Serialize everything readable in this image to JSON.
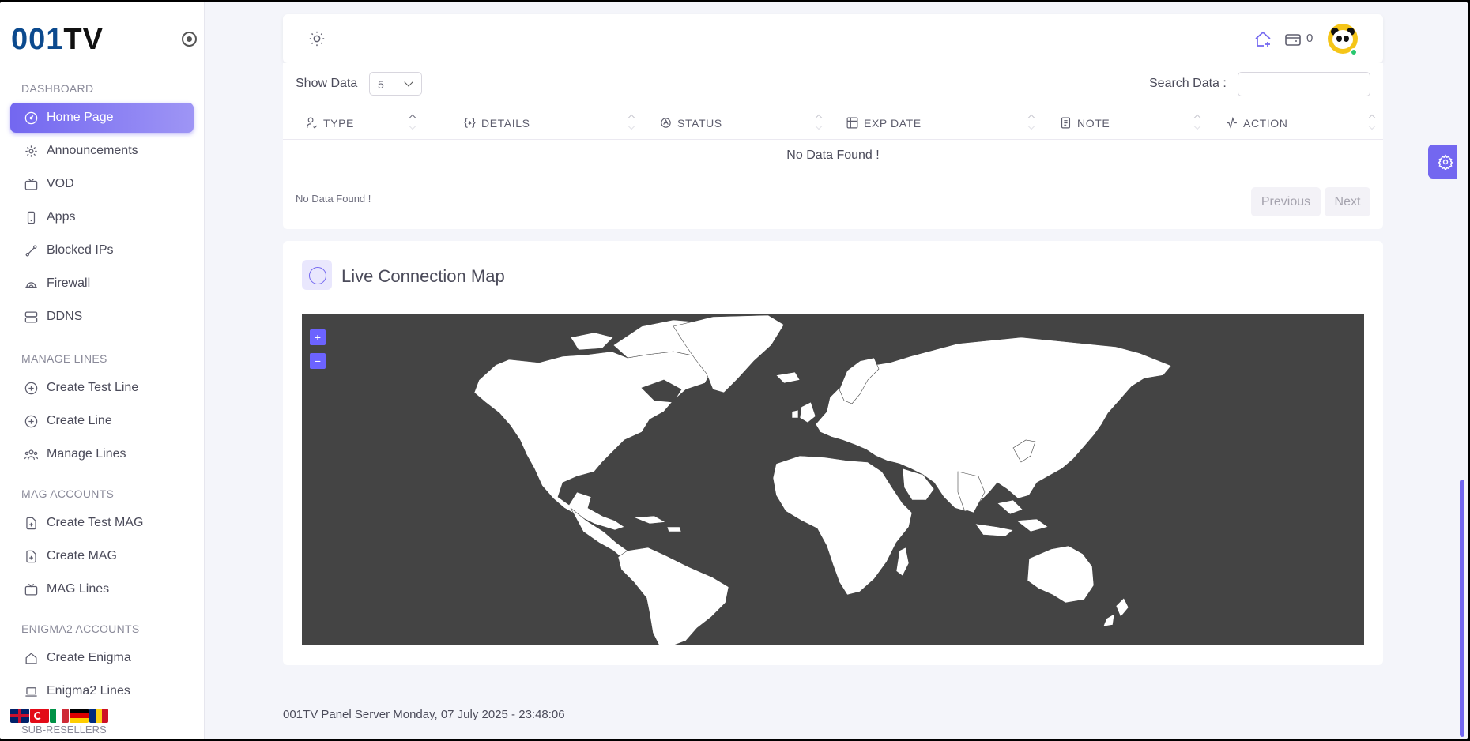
{
  "brand": {
    "logo_main": "001",
    "logo_accent": "TV"
  },
  "sidebar": {
    "sections": [
      {
        "title": "DASHBOARD",
        "items": [
          {
            "label": "Home Page",
            "icon": "dashboard-icon",
            "active": true
          },
          {
            "label": "Announcements",
            "icon": "megaphone-icon"
          },
          {
            "label": "VOD",
            "icon": "tv-icon"
          },
          {
            "label": "Apps",
            "icon": "phone-icon"
          },
          {
            "label": "Blocked IPs",
            "icon": "link-icon"
          },
          {
            "label": "Firewall",
            "icon": "cloud-icon"
          },
          {
            "label": "DDNS",
            "icon": "server-icon"
          }
        ]
      },
      {
        "title": "MANAGE LINES",
        "items": [
          {
            "label": "Create Test Line",
            "icon": "plus-circle-icon"
          },
          {
            "label": "Create Line",
            "icon": "plus-circle-icon"
          },
          {
            "label": "Manage Lines",
            "icon": "users-icon"
          }
        ]
      },
      {
        "title": "MAG ACCOUNTS",
        "items": [
          {
            "label": "Create Test MAG",
            "icon": "file-plus-icon"
          },
          {
            "label": "Create MAG",
            "icon": "file-plus-icon"
          },
          {
            "label": "MAG Lines",
            "icon": "tv-icon"
          }
        ]
      },
      {
        "title": "ENIGMA2 ACCOUNTS",
        "items": [
          {
            "label": "Create Enigma",
            "icon": "home-plus-icon"
          },
          {
            "label": "Enigma2 Lines",
            "icon": "laptop-icon"
          }
        ]
      }
    ],
    "languages": [
      "en",
      "tr",
      "it",
      "de",
      "ro"
    ],
    "partial_section": "SUB-RESELLERS"
  },
  "topbar": {
    "wallet_count": "0",
    "theme_icon": "sun-icon",
    "home_icon": "home-plus-icon",
    "wallet_icon": "wallet-icon"
  },
  "table": {
    "show_label": "Show Data",
    "show_value": "5",
    "search_label": "Search Data :",
    "search_value": "",
    "columns": [
      {
        "label": "TYPE",
        "icon": "user-check-icon"
      },
      {
        "label": "DETAILS",
        "icon": "braces-icon"
      },
      {
        "label": "STATUS",
        "icon": "brand-icon"
      },
      {
        "label": "EXP DATE",
        "icon": "calendar-table-icon"
      },
      {
        "label": "NOTE",
        "icon": "note-icon"
      },
      {
        "label": "ACTION",
        "icon": "activity-icon"
      }
    ],
    "empty_message": "No Data Found !",
    "info": "No Data Found !",
    "prev_label": "Previous",
    "next_label": "Next"
  },
  "map": {
    "title": "Live Connection Map",
    "zoom_in": "+",
    "zoom_out": "−"
  },
  "footer": {
    "text": "001TV Panel Server Monday, 07 July 2025 - 23:48:06"
  },
  "colors": {
    "accent": "#7367f0",
    "map_bg": "#444444",
    "land": "#ffffff"
  }
}
